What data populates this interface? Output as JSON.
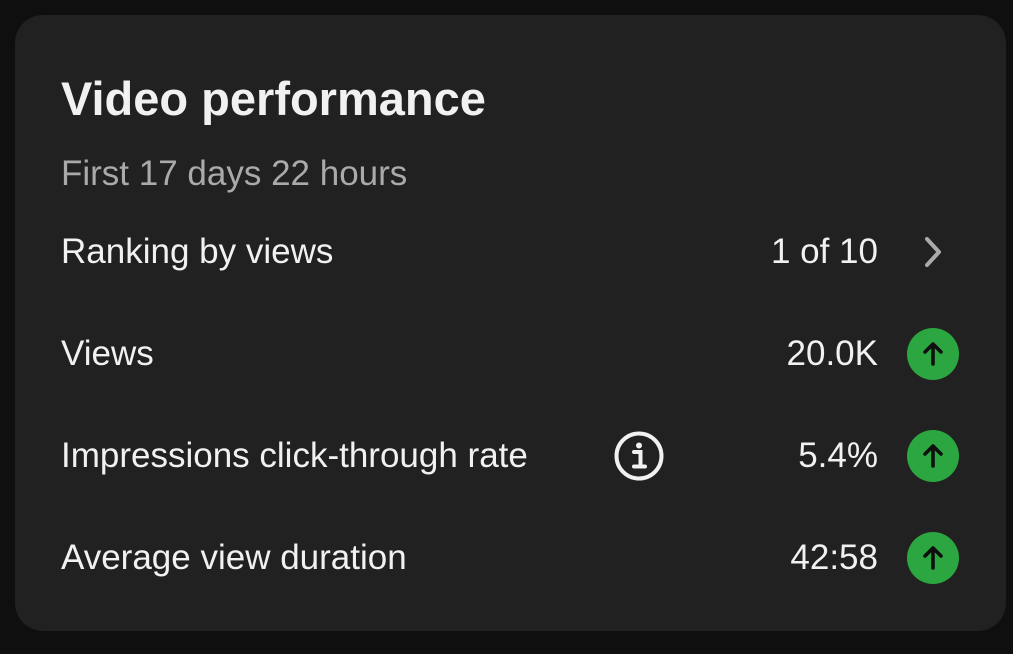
{
  "card": {
    "title": "Video performance",
    "subtitle": "First 17 days 22 hours"
  },
  "rows": [
    {
      "label": "Ranking by views",
      "value": "1 of 10",
      "trailing_icon": "chevron-right-icon"
    },
    {
      "label": "Views",
      "value": "20.0K",
      "trailing_icon": "arrow-up-icon"
    },
    {
      "label": "Impressions click-through rate",
      "value": "5.4%",
      "trailing_icon": "arrow-up-icon",
      "info_icon": "info-icon"
    },
    {
      "label": "Average view duration",
      "value": "42:58",
      "trailing_icon": "arrow-up-icon"
    }
  ],
  "colors": {
    "background": "#0f0f0f",
    "card": "#212121",
    "text_primary": "#f1f1f1",
    "text_secondary": "#aaaaaa",
    "trend_up": "#2ba640"
  }
}
